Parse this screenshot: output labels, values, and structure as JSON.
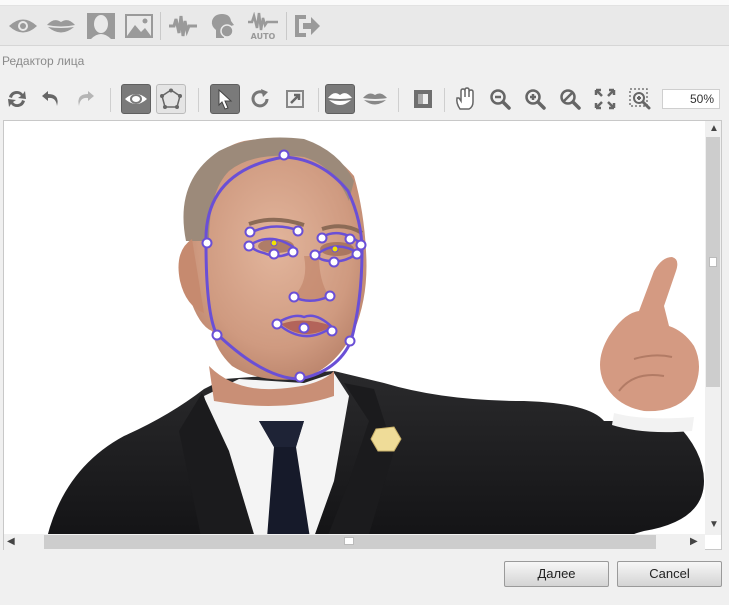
{
  "top_toolbar": {
    "icons": [
      "eye-icon",
      "lips-icon",
      "head-icon",
      "image-icon",
      "waveform-icon",
      "audio-head-icon",
      "auto-wave-icon",
      "exit-icon"
    ],
    "auto_label": "AUTO"
  },
  "section_label": "Редактор лица",
  "editor_toolbar": {
    "icons": [
      "flip-icon",
      "undo-icon",
      "redo-icon",
      "eye-mode-icon",
      "mesh-icon",
      "pointer-icon",
      "rotate-icon",
      "resize-icon",
      "mouth-mode-icon",
      "lips-mode-icon",
      "frame-icon",
      "hand-icon",
      "zoom-out-icon",
      "zoom-in-icon",
      "zoom-reset-icon",
      "fit-icon",
      "zoom-box-icon"
    ],
    "zoom_value": "50%"
  },
  "buttons": {
    "next_label": "Далее",
    "cancel_label": "Cancel"
  },
  "colors": {
    "landmark_stroke": "#6a4fd6",
    "landmark_fill": "#ffffff",
    "pupil_fill": "#f2e600",
    "toolbar_active": "#7a7a7a"
  }
}
